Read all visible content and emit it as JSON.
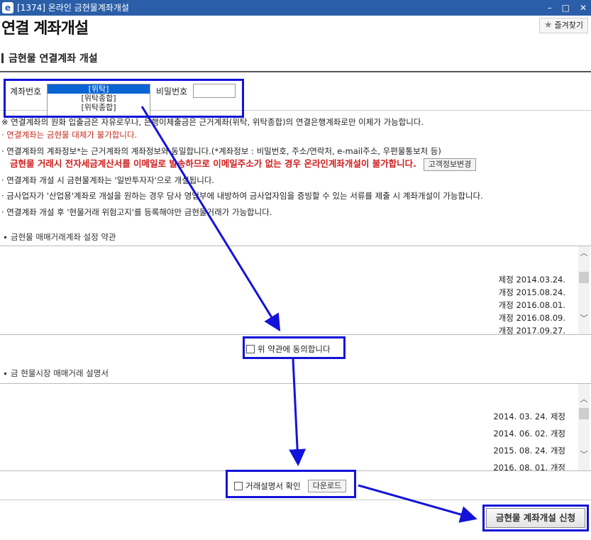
{
  "window": {
    "title": "[1374] 온라인 금현물계좌개설",
    "app_icon": "e",
    "minimize": "–",
    "maximize": "□",
    "close": "✕"
  },
  "page": {
    "title": "연결 계좌개설",
    "favorite_label": "즐겨찾기",
    "favorite_icon": "star-icon"
  },
  "section": {
    "title": "금현물 연결계좌 개설"
  },
  "account": {
    "label": "계좌번호",
    "options": [
      "[위탁]",
      "[위탁종합]",
      "[위탁종합]"
    ],
    "selected_index": 0,
    "password_label": "비밀번호",
    "password_value": ""
  },
  "notes": {
    "n1": "※ 연결계좌의 원화 입출금은 자유로우나, 은행이체출금은 근거계좌(위탁, 위탁종합)의 연결은행계좌로만 이체가 가능합니다.",
    "n2": "· 연결계좌는 금현물 대체가 불가합니다.",
    "n3": "· 연결계좌의 계좌정보*는 근거계좌의 계좌정보와 동일합니다.(*계좌정보 : 비밀번호, 주소/연락처, e-mail주소, 우편물통보처 등)",
    "n4": "금현물 거래시 전자세금계산서를 이메일로 발송하므로 이메일주소가 없는 경우 온라인계좌개설이 불가합니다.",
    "customer_info_button": "고객정보변경",
    "n5": "· 연결계좌 개설 시 금현물계좌는 '일반투자자'으로 개설됩니다.",
    "n6": "· 금사업자가 '산업용'계좌로 개설을 원하는 경우 당사 영업부에 내방하여 금사업자임을 증빙할 수 있는 서류를 제출 시 계좌개설이 가능합니다.",
    "n7": "· 연결계좌 개설 후 '현물거래 위험고지'를 등록해야만 금현물거래가 가능합니다."
  },
  "terms1": {
    "title": "금현물 매매거래계좌 설정 약관",
    "lines": [
      "제정 2014.03.24.",
      "개정 2015.08.24.",
      "개정 2016.08.01.",
      "개정 2016.08.09.",
      "개정 2017.09.27."
    ],
    "agree_label": "위 약관에 동의합니다"
  },
  "terms2": {
    "title": "금 현물시장 매매거래 설명서",
    "lines": [
      "2014. 03. 24. 제정",
      "2014. 06. 02. 개정",
      "2015. 08. 24. 개정",
      "2016. 08. 01. 개정"
    ],
    "confirm_label": "거래설명서 확인",
    "download_label": "다운로드"
  },
  "submit": {
    "label": "금현물 계좌개설 신청"
  },
  "annotation": {
    "color": "#1313d9"
  }
}
